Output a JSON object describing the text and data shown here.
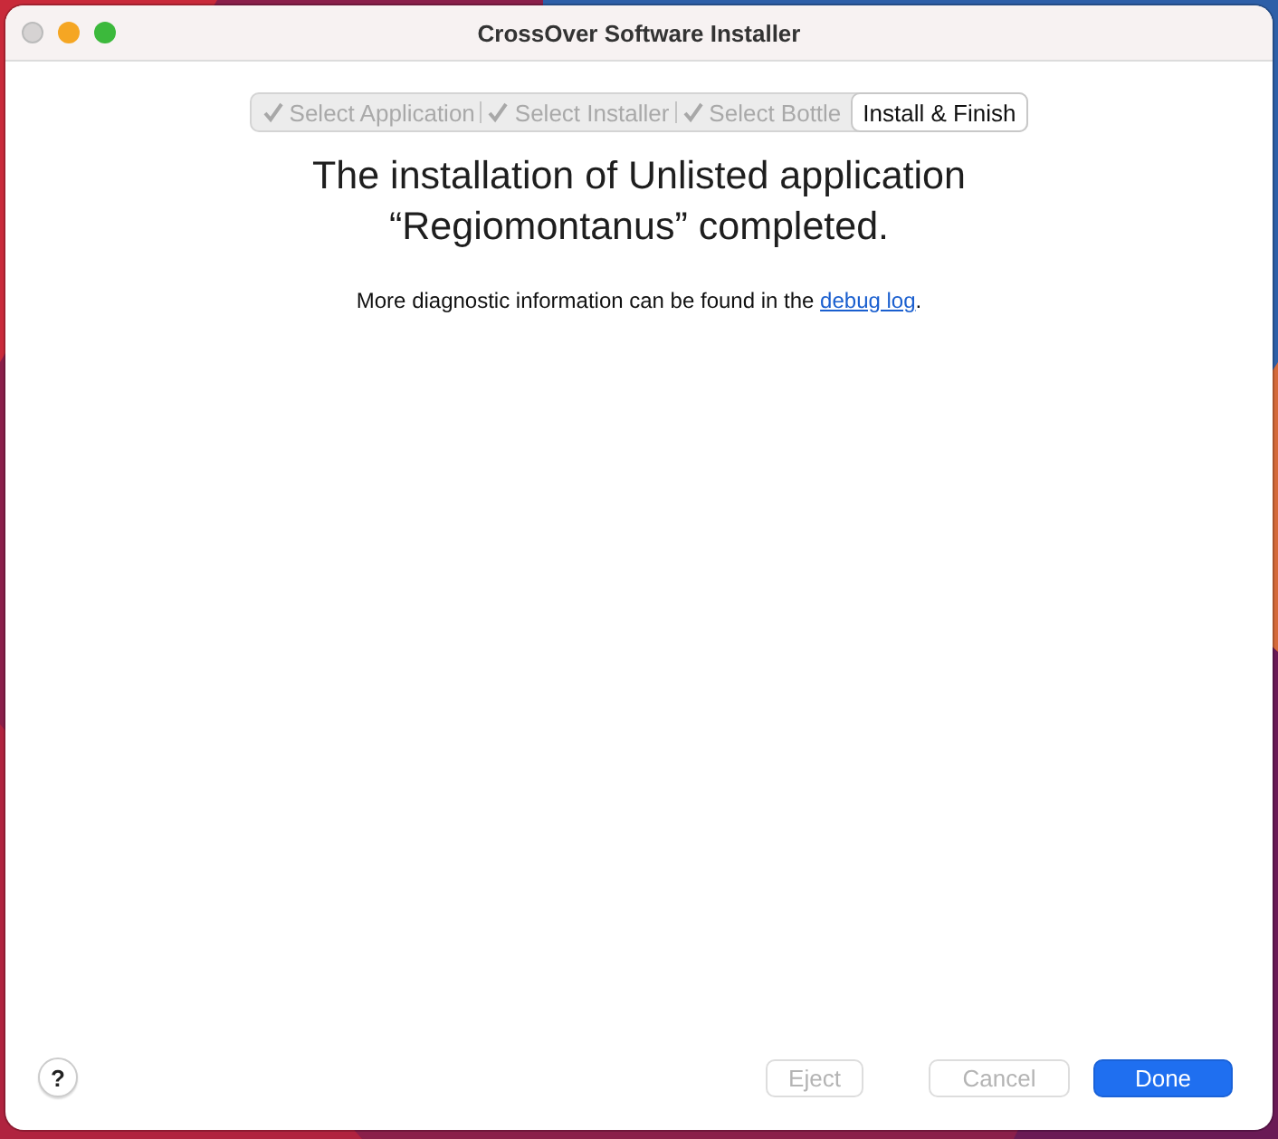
{
  "window": {
    "title": "CrossOver Software Installer"
  },
  "steps": [
    {
      "label": "Select Application",
      "completed": true,
      "selected": false
    },
    {
      "label": "Select Installer",
      "completed": true,
      "selected": false
    },
    {
      "label": "Select Bottle",
      "completed": true,
      "selected": false
    },
    {
      "label": "Install & Finish",
      "completed": false,
      "selected": true
    }
  ],
  "heading": [
    "The installation of Unlisted application",
    "“Regiomontanus” completed."
  ],
  "message": {
    "before": "More diagnostic information can be found in the ",
    "link": "debug log",
    "after": "."
  },
  "help_button": {
    "label": "?"
  },
  "buttons": [
    {
      "label": "Eject",
      "kind": "plain",
      "disabled": true
    },
    {
      "label": "Cancel",
      "kind": "plain",
      "disabled": true
    },
    {
      "label": "Done",
      "kind": "default",
      "disabled": false
    }
  ]
}
